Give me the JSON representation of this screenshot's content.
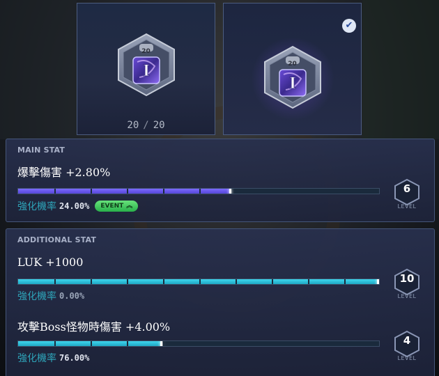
{
  "cards": [
    {
      "emblem_level": "20",
      "current": "20",
      "max": "20",
      "separator": "/",
      "icon": "emblem-hexagon-icon"
    },
    {
      "emblem_level": "20",
      "checked": true,
      "icon": "emblem-hexagon-icon"
    }
  ],
  "main_stat": {
    "section_title": "MAIN STAT",
    "stat": "爆擊傷害 +2.80%",
    "fill": 0.59,
    "rate_label": "強化機率",
    "rate_value": "24.00%",
    "event_label": "EVENT",
    "level": "6",
    "level_word": "LEVEL",
    "color": "#6b5cf0"
  },
  "additional_stat": {
    "section_title": "ADDITIONAL STAT",
    "stats": [
      {
        "stat": "LUK +1000",
        "fill": 1.0,
        "rate_label": "強化機率",
        "rate_value": "0.00%",
        "level": "10",
        "level_word": "LEVEL"
      },
      {
        "stat": "攻擊Boss怪物時傷害 +4.00%",
        "fill": 0.4,
        "rate_label": "強化機率",
        "rate_value": "76.00%",
        "level": "4",
        "level_word": "LEVEL"
      }
    ],
    "color": "#2fc3de"
  }
}
